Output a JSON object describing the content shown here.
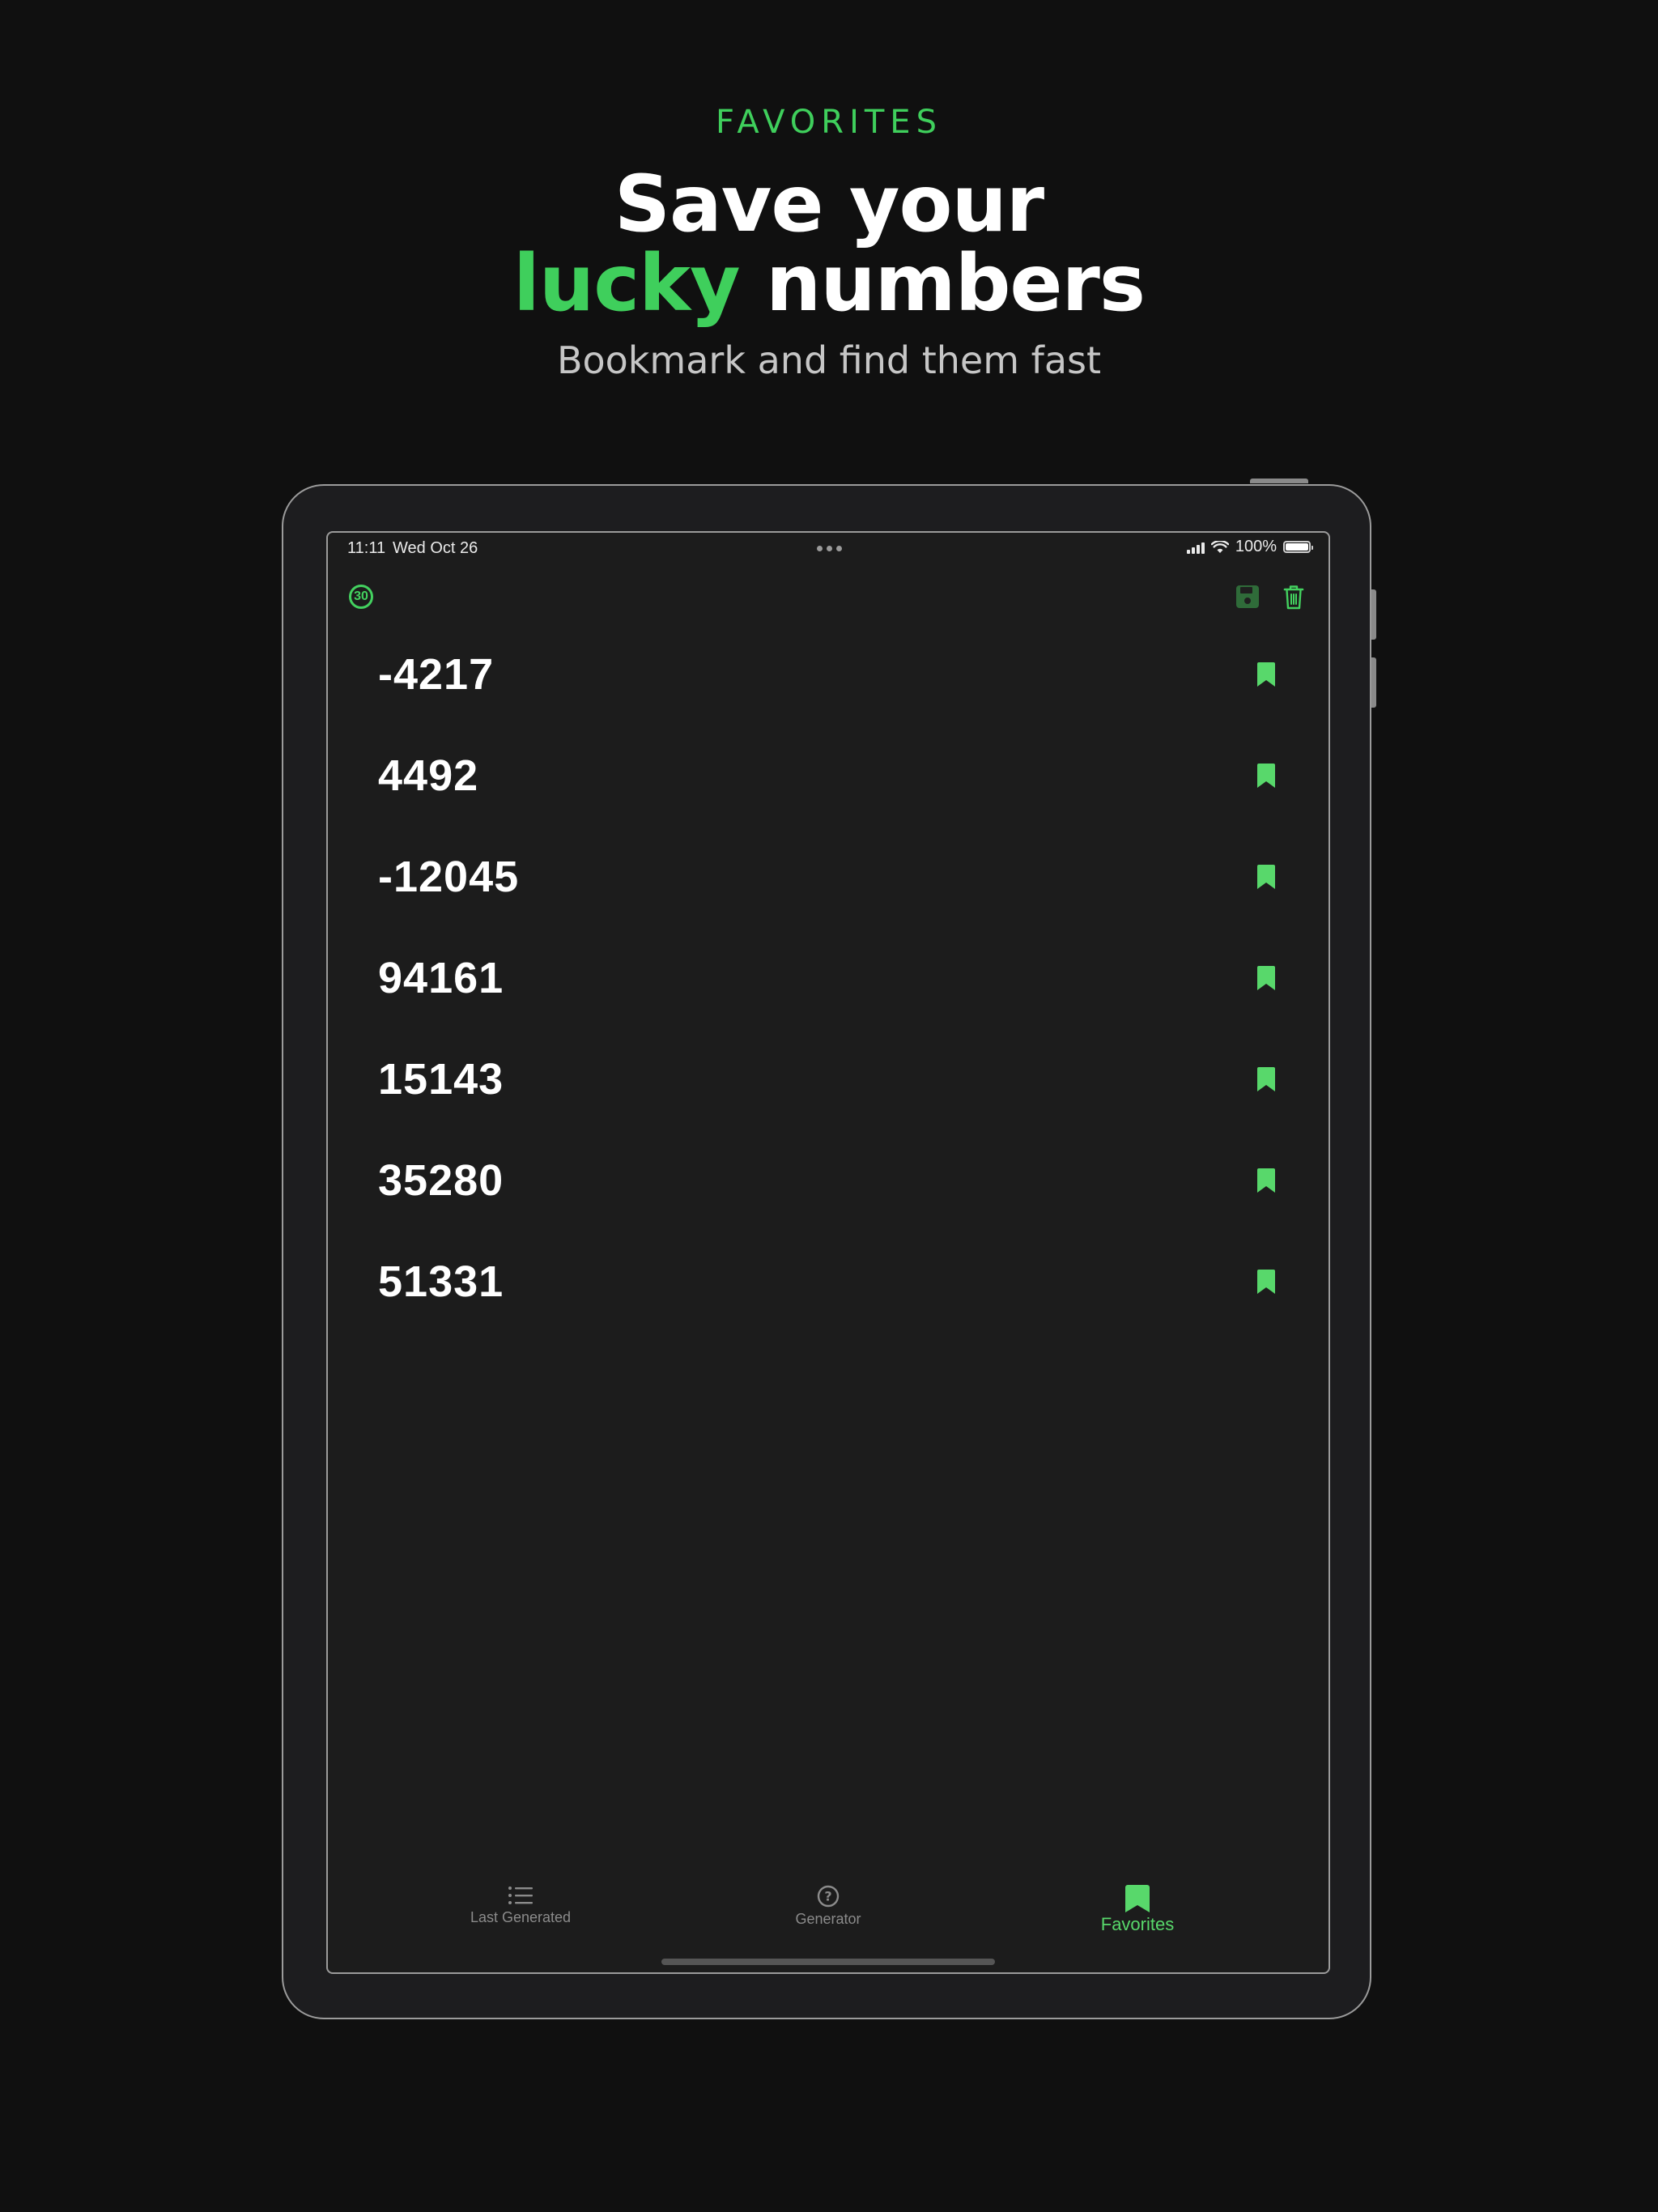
{
  "promo": {
    "eyebrow": "FAVORITES",
    "title_line1": "Save your",
    "title_line2_accent": "lucky",
    "title_line2_rest": " numbers",
    "subtitle": "Bookmark and find them fast"
  },
  "status_bar": {
    "time": "11:11",
    "date": "Wed Oct 26",
    "battery": "100%"
  },
  "toolbar": {
    "badge_count": "30",
    "save_icon": "floppy-disk-icon",
    "trash_icon": "trash-icon"
  },
  "favorites": [
    {
      "value": "-4217"
    },
    {
      "value": "4492"
    },
    {
      "value": "-12045"
    },
    {
      "value": "94161"
    },
    {
      "value": "15143"
    },
    {
      "value": "35280"
    },
    {
      "value": "51331"
    }
  ],
  "tab_bar": {
    "tabs": [
      {
        "label": "Last Generated",
        "icon": "list-icon"
      },
      {
        "label": "Generator",
        "icon": "question-circle-icon"
      },
      {
        "label": "Favorites",
        "icon": "bookmark-icon",
        "selected": true
      }
    ]
  },
  "colors": {
    "background": "#101010",
    "accent": "#3fcf5c",
    "screen": "#1c1c1c",
    "bookmark": "#58d86b"
  }
}
